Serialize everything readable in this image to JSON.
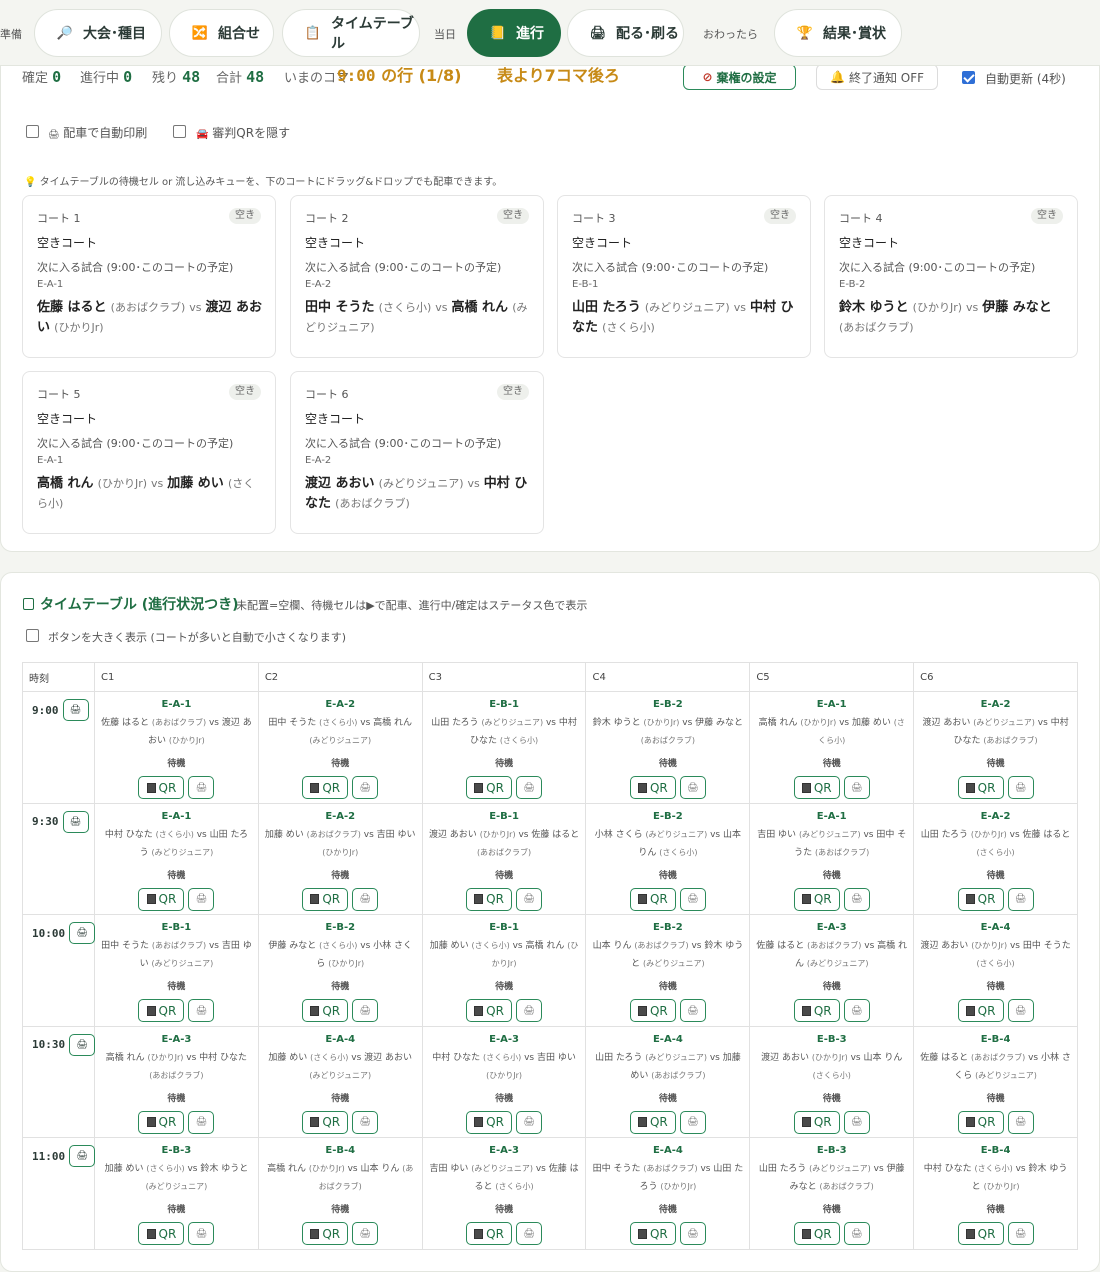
{
  "nav": {
    "left_text": "準備",
    "items": [
      {
        "label": "大会･種目",
        "icon": "🔎"
      },
      {
        "label": "組合せ",
        "icon": "🔀"
      },
      {
        "label": "タイムテーブル",
        "icon": "📋"
      }
    ],
    "sep1": "当日",
    "active": {
      "label": "進行",
      "icon": "📒"
    },
    "print": {
      "label": "配る･刷る",
      "icon": "🖨"
    },
    "sep2": "おわったら",
    "results": {
      "label": "結果･賞状",
      "icon": "🏆"
    }
  },
  "status": {
    "confirmed_label": "確定",
    "confirmed": "0",
    "inprogress_label": "進行中",
    "inprogress": "0",
    "remaining_label": "残り",
    "remaining": "48",
    "total_label": "合計",
    "total": "48",
    "now_label": "いまのコマ",
    "now_time": "9:00",
    "now_row": "の行 (1/8)",
    "behind": "表より7コマ後ろ"
  },
  "controls": {
    "abstain": "棄権の設定",
    "notify": "終了通知 OFF",
    "auto_update": "自動更新 (4秒)",
    "auto_print": "配車で自動印刷",
    "hide_qr": "審判QRを隠す",
    "hint": "タイムテーブルの待機セル or 流し込みキューを、下のコートにドラッグ&ドロップでも配車できます。"
  },
  "courts": [
    {
      "name": "コート 1",
      "badge": "空き",
      "status": "空きコート",
      "next": "次に入る試合 (9:00･このコートの予定)",
      "event": "E-A-1",
      "p1": "佐藤 はると",
      "c1": "(あおばクラブ)",
      "p2": "渡辺 あおい",
      "c2": "(ひかりJr)"
    },
    {
      "name": "コート 2",
      "badge": "空き",
      "status": "空きコート",
      "next": "次に入る試合 (9:00･このコートの予定)",
      "event": "E-A-2",
      "p1": "田中 そうた",
      "c1": "(さくら小)",
      "p2": "高橋 れん",
      "c2": "(みどりジュニア)"
    },
    {
      "name": "コート 3",
      "badge": "空き",
      "status": "空きコート",
      "next": "次に入る試合 (9:00･このコートの予定)",
      "event": "E-B-1",
      "p1": "山田 たろう",
      "c1": "(みどりジュニア)",
      "p2": "中村 ひなた",
      "c2": "(さくら小)"
    },
    {
      "name": "コート 4",
      "badge": "空き",
      "status": "空きコート",
      "next": "次に入る試合 (9:00･このコートの予定)",
      "event": "E-B-2",
      "p1": "鈴木 ゆうと",
      "c1": "(ひかりJr)",
      "p2": "伊藤 みなと",
      "c2": "(あおばクラブ)"
    },
    {
      "name": "コート 5",
      "badge": "空き",
      "status": "空きコート",
      "next": "次に入る試合 (9:00･このコートの予定)",
      "event": "E-A-1",
      "p1": "高橋 れん",
      "c1": "(ひかりJr)",
      "p2": "加藤 めい",
      "c2": "(さくら小)"
    },
    {
      "name": "コート 6",
      "badge": "空き",
      "status": "空きコート",
      "next": "次に入る試合 (9:00･このコートの予定)",
      "event": "E-A-2",
      "p1": "渡辺 あおい",
      "c1": "(みどりジュニア)",
      "p2": "中村 ひなた",
      "c2": "(あおばクラブ)"
    }
  ],
  "timetable": {
    "title": "タイムテーブル (進行状況つき)",
    "subtitle": "未配置=空欄、待機セルは▶で配車、進行中/確定はステータス色で表示",
    "big_buttons": "ボタンを大きく表示 (コートが多いと自動で小さくなります)",
    "headers": [
      "時刻",
      "C1",
      "C2",
      "C3",
      "C4",
      "C5",
      "C6"
    ],
    "status": "待機",
    "qr": "QR",
    "rows": [
      {
        "time": "9:00",
        "cells": [
          {
            "ev": "E-A-1",
            "p1": "佐藤 はると",
            "c1": "(あおばクラブ)",
            "p2": "渡辺 あおい",
            "c2": "(ひかりJr)"
          },
          {
            "ev": "E-A-2",
            "p1": "田中 そうた",
            "c1": "(さくら小)",
            "p2": "高橋 れん",
            "c2": "(みどりジュニア)"
          },
          {
            "ev": "E-B-1",
            "p1": "山田 たろう",
            "c1": "(みどりジュニア)",
            "p2": "中村 ひなた",
            "c2": "(さくら小)"
          },
          {
            "ev": "E-B-2",
            "p1": "鈴木 ゆうと",
            "c1": "(ひかりJr)",
            "p2": "伊藤 みなと",
            "c2": "(あおばクラブ)"
          },
          {
            "ev": "E-A-1",
            "p1": "高橋 れん",
            "c1": "(ひかりJr)",
            "p2": "加藤 めい",
            "c2": "(さくら小)"
          },
          {
            "ev": "E-A-2",
            "p1": "渡辺 あおい",
            "c1": "(みどりジュニア)",
            "p2": "中村 ひなた",
            "c2": "(あおばクラブ)"
          }
        ]
      },
      {
        "time": "9:30",
        "cells": [
          {
            "ev": "E-A-1",
            "p1": "中村 ひなた",
            "c1": "(さくら小)",
            "p2": "山田 たろう",
            "c2": "(みどりジュニア)"
          },
          {
            "ev": "E-A-2",
            "p1": "加藤 めい",
            "c1": "(あおばクラブ)",
            "p2": "吉田 ゆい",
            "c2": "(ひかりJr)"
          },
          {
            "ev": "E-B-1",
            "p1": "渡辺 あおい",
            "c1": "(ひかりJr)",
            "p2": "佐藤 はると",
            "c2": "(あおばクラブ)"
          },
          {
            "ev": "E-B-2",
            "p1": "小林 さくら",
            "c1": "(みどりジュニア)",
            "p2": "山本 りん",
            "c2": "(さくら小)"
          },
          {
            "ev": "E-A-1",
            "p1": "吉田 ゆい",
            "c1": "(みどりジュニア)",
            "p2": "田中 そうた",
            "c2": "(あおばクラブ)"
          },
          {
            "ev": "E-A-2",
            "p1": "山田 たろう",
            "c1": "(ひかりJr)",
            "p2": "佐藤 はると",
            "c2": "(さくら小)"
          }
        ]
      },
      {
        "time": "10:00",
        "cells": [
          {
            "ev": "E-B-1",
            "p1": "田中 そうた",
            "c1": "(あおばクラブ)",
            "p2": "吉田 ゆい",
            "c2": "(みどりジュニア)"
          },
          {
            "ev": "E-B-2",
            "p1": "伊藤 みなと",
            "c1": "(さくら小)",
            "p2": "小林 さくら",
            "c2": "(ひかりJr)"
          },
          {
            "ev": "E-B-1",
            "p1": "加藤 めい",
            "c1": "(さくら小)",
            "p2": "高橋 れん",
            "c2": "(ひかりJr)"
          },
          {
            "ev": "E-B-2",
            "p1": "山本 りん",
            "c1": "(あおばクラブ)",
            "p2": "鈴木 ゆうと",
            "c2": "(みどりジュニア)"
          },
          {
            "ev": "E-A-3",
            "p1": "佐藤 はると",
            "c1": "(あおばクラブ)",
            "p2": "高橋 れん",
            "c2": "(みどりジュニア)"
          },
          {
            "ev": "E-A-4",
            "p1": "渡辺 あおい",
            "c1": "(ひかりJr)",
            "p2": "田中 そうた",
            "c2": "(さくら小)"
          }
        ]
      },
      {
        "time": "10:30",
        "cells": [
          {
            "ev": "E-A-3",
            "p1": "高橋 れん",
            "c1": "(ひかりJr)",
            "p2": "中村 ひなた",
            "c2": "(あおばクラブ)"
          },
          {
            "ev": "E-A-4",
            "p1": "加藤 めい",
            "c1": "(さくら小)",
            "p2": "渡辺 あおい",
            "c2": "(みどりジュニア)"
          },
          {
            "ev": "E-A-3",
            "p1": "中村 ひなた",
            "c1": "(さくら小)",
            "p2": "吉田 ゆい",
            "c2": "(ひかりJr)"
          },
          {
            "ev": "E-A-4",
            "p1": "山田 たろう",
            "c1": "(みどりジュニア)",
            "p2": "加藤 めい",
            "c2": "(あおばクラブ)"
          },
          {
            "ev": "E-B-3",
            "p1": "渡辺 あおい",
            "c1": "(ひかりJr)",
            "p2": "山本 りん",
            "c2": "(さくら小)"
          },
          {
            "ev": "E-B-4",
            "p1": "佐藤 はると",
            "c1": "(あおばクラブ)",
            "p2": "小林 さくら",
            "c2": "(みどりジュニア)"
          }
        ]
      },
      {
        "time": "11:00",
        "cells": [
          {
            "ev": "E-B-3",
            "p1": "加藤 めい",
            "c1": "(さくら小)",
            "p2": "鈴木 ゆうと",
            "c2": "(みどりジュニア)"
          },
          {
            "ev": "E-B-4",
            "p1": "高橋 れん",
            "c1": "(ひかりJr)",
            "p2": "山本 りん",
            "c2": "(あおばクラブ)"
          },
          {
            "ev": "E-A-3",
            "p1": "吉田 ゆい",
            "c1": "(みどりジュニア)",
            "p2": "佐藤 はると",
            "c2": "(さくら小)"
          },
          {
            "ev": "E-A-4",
            "p1": "田中 そうた",
            "c1": "(あおばクラブ)",
            "p2": "山田 たろう",
            "c2": "(ひかりJr)"
          },
          {
            "ev": "E-B-3",
            "p1": "山田 たろう",
            "c1": "(みどりジュニア)",
            "p2": "伊藤 みなと",
            "c2": "(あおばクラブ)"
          },
          {
            "ev": "E-B-4",
            "p1": "中村 ひなた",
            "c1": "(さくら小)",
            "p2": "鈴木 ゆうと",
            "c2": "(ひかりJr)"
          }
        ]
      }
    ]
  },
  "colors": {
    "accent": "#1f6e43",
    "brand_green": "#2b8a5a",
    "behind": "#c78a16",
    "check": "#2f6fd6"
  },
  "icons": {
    "print": "printer-icon",
    "qr": "qr-icon",
    "bell": "bell-icon",
    "ban": "ban-icon",
    "bulb": "bulb-icon",
    "car": "car-icon"
  }
}
